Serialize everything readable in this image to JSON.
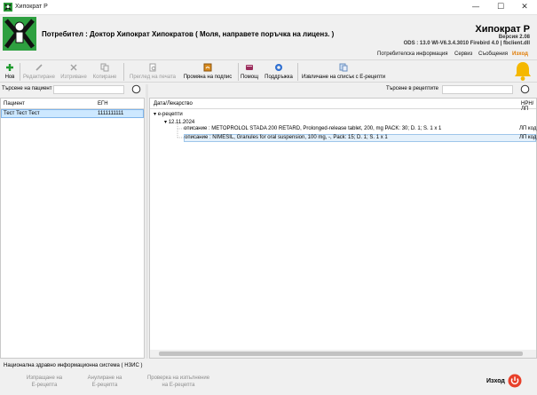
{
  "window": {
    "title": "Хипократ Р",
    "controls": {
      "minimize": "—",
      "maximize": "☐",
      "close": "✕"
    }
  },
  "header": {
    "user_line": "Потребител : Доктор Хипократ Хипократов ( Моля, направете поръчка на лиценз. )",
    "brand": "Хипократ Р",
    "version": "Версия 2.08",
    "ods_line": "ODS : 13.0 WI-V6.3.4.3010 Firebird 4.0  |  fbclient.dll"
  },
  "menu": {
    "items": [
      "Потребителска информация",
      "Сервиз",
      "Съобщения"
    ],
    "exit": "Изход"
  },
  "toolbar": {
    "new": "Нов",
    "edit": "Редактиране",
    "delete": "Изтриване",
    "copy": "Копиране",
    "print_preview": "Преглед на печата",
    "sign_change": "Промяна на подпис",
    "help": "Помощ",
    "support": "Поддръжка",
    "fetch_list": "Извличане на списък с Е-рецепти"
  },
  "left_panel": {
    "search_label": "Търсене на пациент",
    "search_value": "",
    "columns": [
      "Пациент",
      "ЕГН"
    ],
    "patients": [
      {
        "name": "Тест Тест Тест",
        "egn": "1111111111"
      }
    ]
  },
  "right_panel": {
    "search_label": "Търсене в рецептите",
    "search_value": "",
    "columns": [
      "Дата/Лекарство",
      "НРН/ЛП"
    ],
    "tree": {
      "root": "е-рецепти",
      "date": "12.11.2024",
      "items": [
        {
          "text": "описание : METOPROLOL STADA 200 RETARD, Prolonged-release tablet, 200, mg PACK: 30; D. 1; S. 1 x 1",
          "code": "ЛП код"
        },
        {
          "text": "описание : NIMESIL, Granules for oral suspension, 100 mg, -, Pack: 15; D. 1; S. 1 x 1",
          "code": "ЛП код"
        }
      ]
    }
  },
  "bottom": {
    "nzis_label": "Национална здравно информационна система ( НЗИС )",
    "send": [
      "Изпращане на",
      "Е-рецепта"
    ],
    "cancel": [
      "Анулиране на",
      "Е-рецепта"
    ],
    "check": [
      "Проверка на изпълнение",
      "на Е-рецепта"
    ],
    "exit": "Изход"
  },
  "colors": {
    "selection": "#cde8ff",
    "accent_orange": "#e07a00",
    "bell": "#f5b800",
    "exit_red": "#e8402a"
  }
}
